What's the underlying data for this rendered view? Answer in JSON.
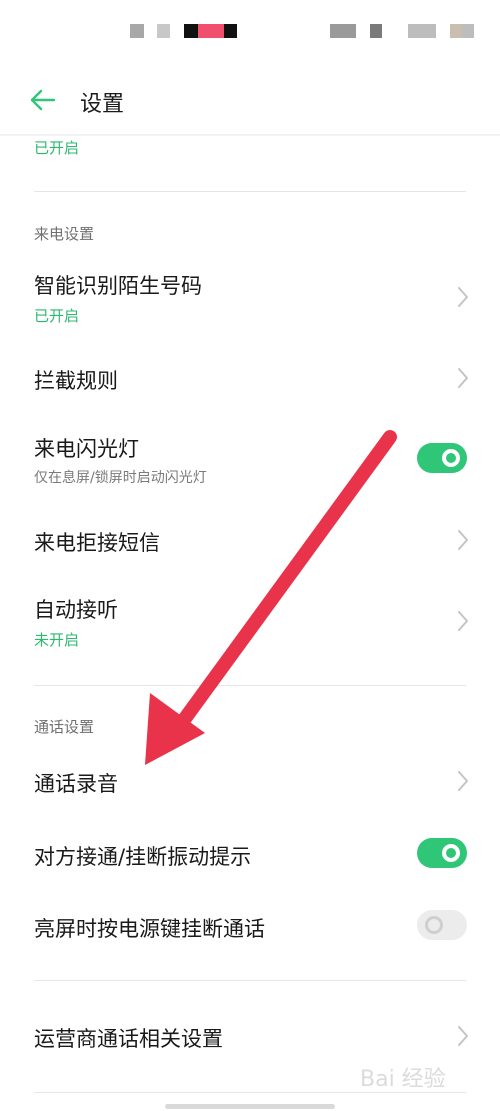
{
  "header": {
    "title": "设置"
  },
  "top_item": {
    "status": "已开启"
  },
  "sections": {
    "incoming": {
      "label": "来电设置"
    },
    "call": {
      "label": "通话设置"
    }
  },
  "items": [
    {
      "title": "智能识别陌生号码",
      "sub": "已开启",
      "control": "chevron"
    },
    {
      "title": "拦截规则",
      "control": "chevron"
    },
    {
      "title": "来电闪光灯",
      "sub": "仅在息屏/锁屏时启动闪光灯",
      "control": "toggle",
      "on": true
    },
    {
      "title": "来电拒接短信",
      "control": "chevron"
    },
    {
      "title": "自动接听",
      "sub": "未开启",
      "control": "chevron"
    },
    {
      "title": "通话录音",
      "control": "chevron"
    },
    {
      "title": "对方接通/挂断振动提示",
      "control": "toggle",
      "on": true
    },
    {
      "title": "亮屏时按电源键挂断通话",
      "control": "toggle",
      "on": false
    },
    {
      "title": "运营商通话相关设置",
      "control": "chevron"
    }
  ],
  "colors": {
    "accent": "#2fc677",
    "status_green": "#2db870",
    "annotation_arrow": "#e8334a"
  },
  "icons": {
    "back": "arrow-left-icon",
    "chevron": "chevron-right-icon",
    "watermark": "baidu-jingyan-logo"
  },
  "watermark_text": "Bai 经验"
}
